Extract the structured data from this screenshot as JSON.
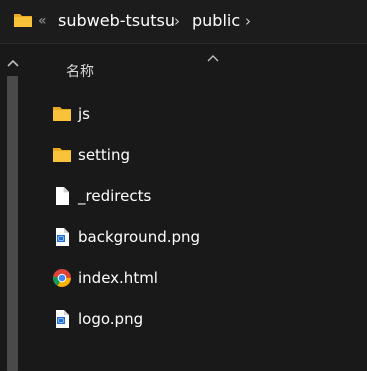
{
  "address_bar": {
    "overflow_glyph": "«",
    "crumbs": [
      "subweb-tsutsu",
      "public"
    ],
    "separator": "›",
    "folder_icon": "folder-icon"
  },
  "list": {
    "column_header": "名称",
    "sort_indicator": "chevron-up-icon",
    "items": [
      {
        "name": "js",
        "icon": "folder-icon"
      },
      {
        "name": "setting",
        "icon": "folder-icon"
      },
      {
        "name": "_redirects",
        "icon": "blank-file-icon"
      },
      {
        "name": "background.png",
        "icon": "image-file-icon"
      },
      {
        "name": "index.html",
        "icon": "chrome-icon"
      },
      {
        "name": "logo.png",
        "icon": "image-file-icon"
      }
    ]
  },
  "colors": {
    "background": "#191919",
    "folder_yellow": "#f8c33a",
    "scrollbar": "#4a4a4a"
  }
}
